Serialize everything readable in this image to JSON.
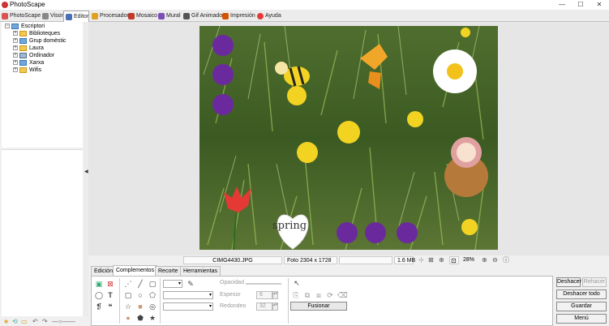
{
  "window": {
    "title": "PhotoScape",
    "minimize": "—",
    "maximize": "☐",
    "close": "✕"
  },
  "tabs": [
    {
      "label": "PhotoScape",
      "icon": "photoscape-icon",
      "color": "#d9534f"
    },
    {
      "label": "Visor",
      "icon": "viewer-icon",
      "color": "#888888"
    },
    {
      "label": "Editor",
      "icon": "editor-icon",
      "color": "#4a6fb5"
    },
    {
      "label": "Procesador",
      "icon": "batch-icon",
      "color": "#e0a020"
    },
    {
      "label": "Mosaico",
      "icon": "page-icon",
      "color": "#c0392b"
    },
    {
      "label": "Mural",
      "icon": "combine-icon",
      "color": "#7a4fb5"
    },
    {
      "label": "Gif Animado",
      "icon": "gif-icon",
      "color": "#555555"
    },
    {
      "label": "Impresión",
      "icon": "print-icon",
      "color": "#d35400"
    },
    {
      "label": "Ayuda",
      "icon": "help-icon",
      "color": "#e53935"
    }
  ],
  "tree": {
    "root": "Escriptori",
    "items": [
      "Biblioteques",
      "Grup domèstic",
      "Laura",
      "Ordinador",
      "Xarxa",
      "Wifis"
    ]
  },
  "status": {
    "filename": "CIMG4430.JPG",
    "photo_info": "Foto 2304 x 1728",
    "file_size": "1.6 MB",
    "zoom": "28%"
  },
  "panel_tabs": [
    "Edición",
    "Complementos",
    "Recorte",
    "Herramientas"
  ],
  "panel": {
    "opacity_label": "Opacidad",
    "thickness_label": "Espesor",
    "thickness_value": "6",
    "rounding_label": "Redondeo",
    "rounding_value": "32",
    "merge_button": "Fusionar"
  },
  "right_buttons": {
    "undo": "Deshacer",
    "redo": "Rehacer",
    "undo_all": "Deshacer todo",
    "save": "Guardar",
    "menu": "Menú"
  },
  "photo_sticker_text": "spring"
}
